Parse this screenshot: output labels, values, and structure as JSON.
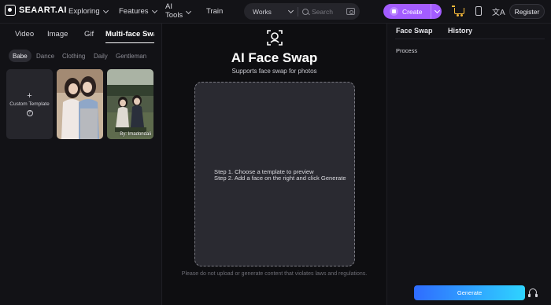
{
  "header": {
    "logo_text": "SEAART.AI",
    "nav": [
      {
        "label": "Exploring"
      },
      {
        "label": "Features"
      },
      {
        "label_line1": "AI",
        "label_line2": "Tools"
      },
      {
        "label": "Train"
      }
    ],
    "search_scope": "Works",
    "search_placeholder": "Search",
    "create_label": "Create",
    "register_label": "Register",
    "translate_glyph": "文A"
  },
  "left_panel": {
    "tabs": [
      {
        "label": "Video"
      },
      {
        "label": "Image"
      },
      {
        "label": "Gif"
      },
      {
        "label": "Multi-face Swap",
        "active": true
      }
    ],
    "categories": [
      {
        "label": "Babe",
        "active": true
      },
      {
        "label": "Dance"
      },
      {
        "label": "Clothing"
      },
      {
        "label": "Daily"
      },
      {
        "label": "Gentleman"
      }
    ],
    "custom_template_label": "Custom Template",
    "custom_plus": "+",
    "help_glyph": "?",
    "photo_caption": "By: Imadondali"
  },
  "center": {
    "title": "AI Face Swap",
    "subtitle": "Supports face swap for photos",
    "step1": "Step 1. Choose a template to preview",
    "step2": "Step 2. Add a face on the right and click Generate",
    "disclaimer": "Please do not upload or generate content that violates laws and regulations."
  },
  "right_panel": {
    "tabs": [
      {
        "label": "Face Swap",
        "active": true
      },
      {
        "label": "History"
      }
    ],
    "process_label": "Process",
    "generate_label": "Generate"
  },
  "colors": {
    "accent_purple": "#a35cff",
    "generate_gradient_start": "#2f6cff",
    "generate_gradient_end": "#2fd4ff",
    "cart_gold": "#f3b73a"
  }
}
